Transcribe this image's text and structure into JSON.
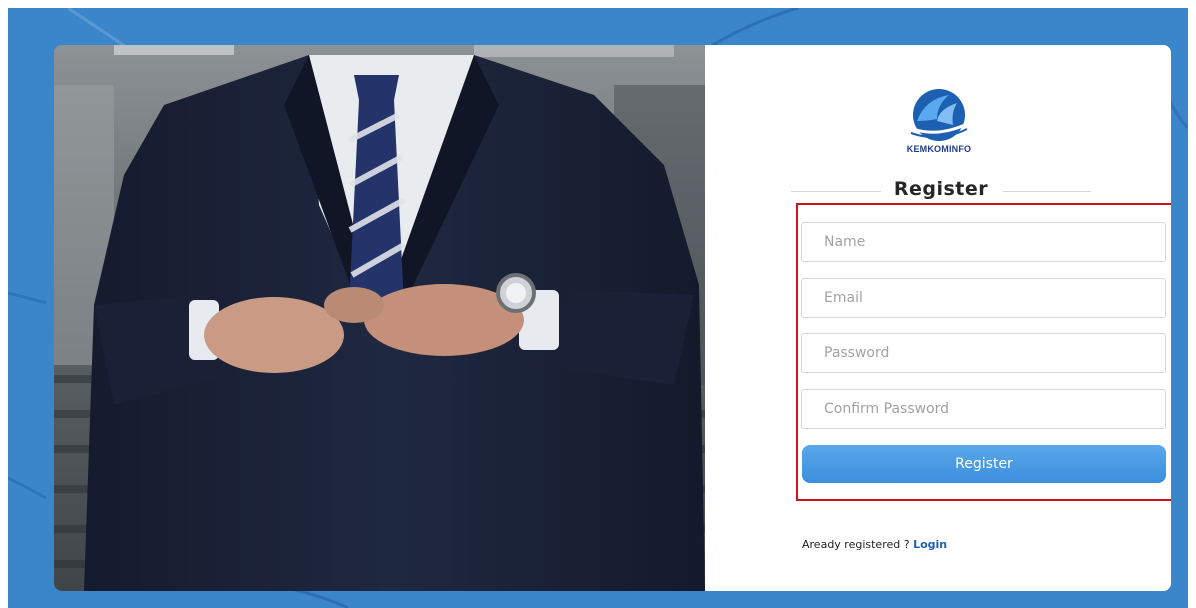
{
  "logo": {
    "text": "KEMKOMINFO",
    "colors": {
      "primary": "#1d5fb0",
      "light": "#5aa8ee"
    }
  },
  "form": {
    "title": "Register",
    "fields": [
      {
        "name": "name",
        "placeholder": "Name"
      },
      {
        "name": "email",
        "placeholder": "Email"
      },
      {
        "name": "password",
        "placeholder": "Password"
      },
      {
        "name": "confirm_password",
        "placeholder": "Confirm Password"
      }
    ],
    "submit_label": "Register"
  },
  "footer": {
    "prompt": "Aready registered ? ",
    "login_label": "Login"
  },
  "colors": {
    "background": "#3b86cb",
    "button": "#3c8fdc",
    "highlight_border": "#c8171e",
    "link": "#1f5fb8"
  }
}
